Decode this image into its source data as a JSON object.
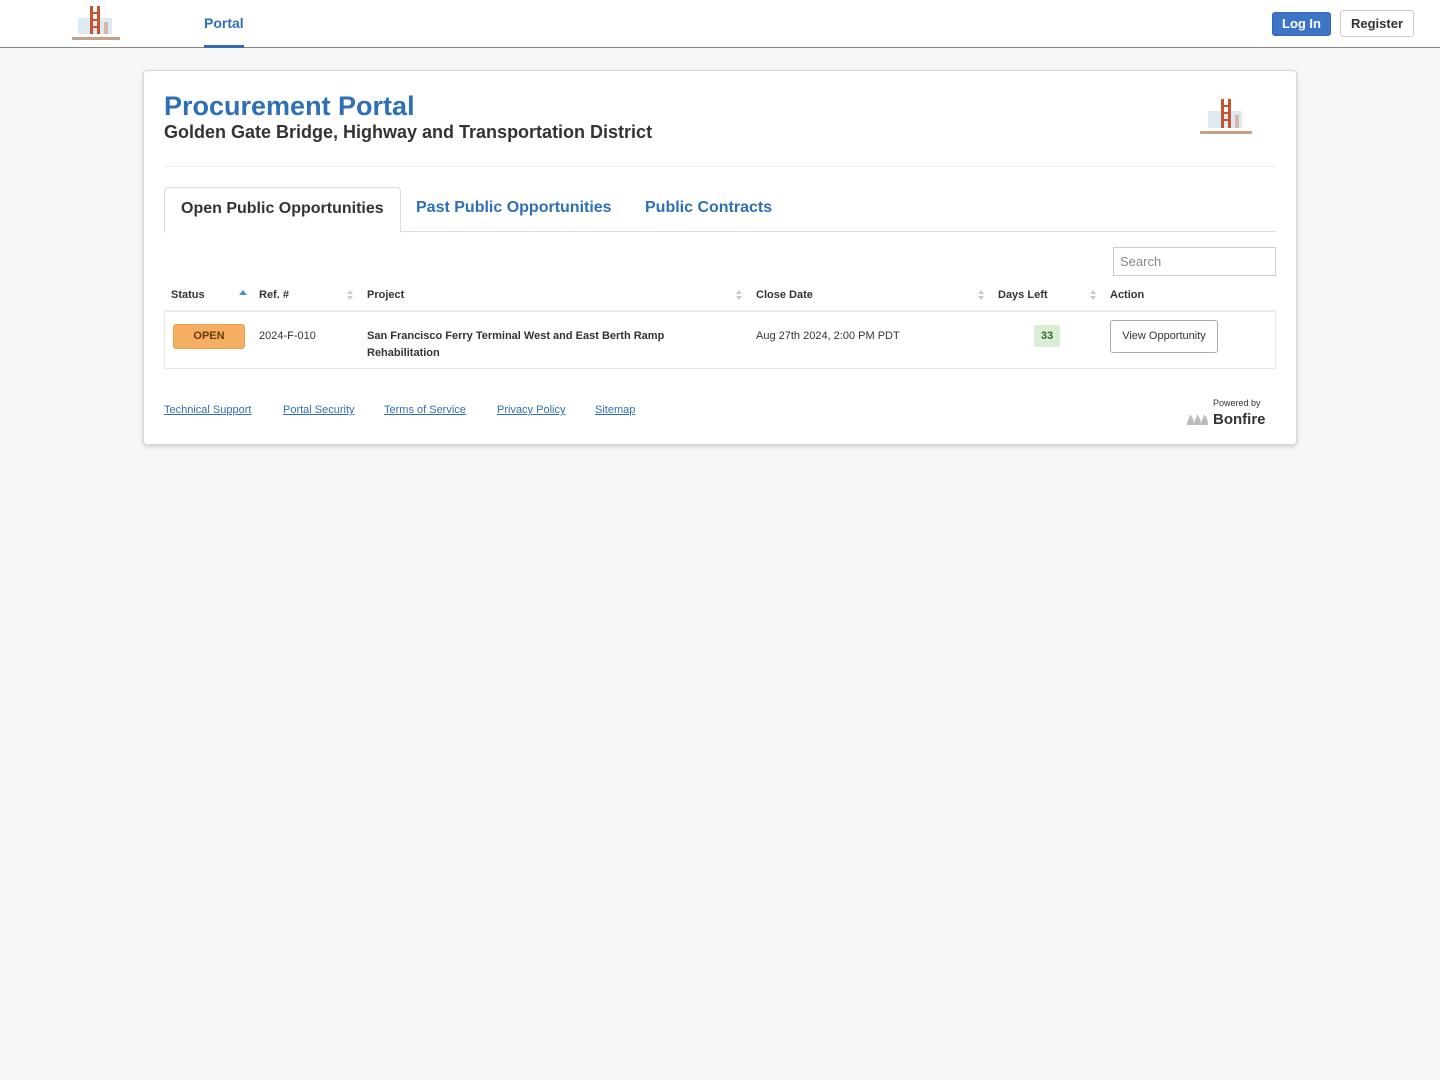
{
  "topbar": {
    "logo_alt": "Golden Gate Bridge logo",
    "nav_portal": "Portal",
    "login_label": "Log In",
    "register_label": "Register"
  },
  "header": {
    "title": "Procurement Portal",
    "subtitle": "Golden Gate Bridge, Highway and Transportation District"
  },
  "tabs": [
    {
      "label": "Open Public Opportunities",
      "active": true
    },
    {
      "label": "Past Public Opportunities",
      "active": false
    },
    {
      "label": "Public Contracts",
      "active": false
    }
  ],
  "search": {
    "placeholder": "Search",
    "value": ""
  },
  "table": {
    "columns": [
      {
        "label": "Status",
        "sort": "asc"
      },
      {
        "label": "Ref. #",
        "sort": "none"
      },
      {
        "label": "Project",
        "sort": "none"
      },
      {
        "label": "Close Date",
        "sort": "none"
      },
      {
        "label": "Days Left",
        "sort": "none"
      },
      {
        "label": "Action",
        "sort": null
      }
    ],
    "rows": [
      {
        "status": "OPEN",
        "ref": "2024-F-010",
        "project": "San Francisco Ferry Terminal West and East Berth Ramp Rehabilitation",
        "close_date": "Aug 27th 2024, 2:00 PM PDT",
        "days_left": "33",
        "action": "View Opportunity"
      }
    ]
  },
  "footer": {
    "links": [
      "Technical Support",
      "Portal Security",
      "Terms of Service",
      "Privacy Policy",
      "Sitemap"
    ],
    "powered_by": "Powered by",
    "brand": "Bonfire"
  },
  "colors": {
    "accent": "#2e6fb5",
    "login_bg": "#3d74c6",
    "open_badge": "#f5ae62",
    "days_badge": "#d9eed5"
  }
}
